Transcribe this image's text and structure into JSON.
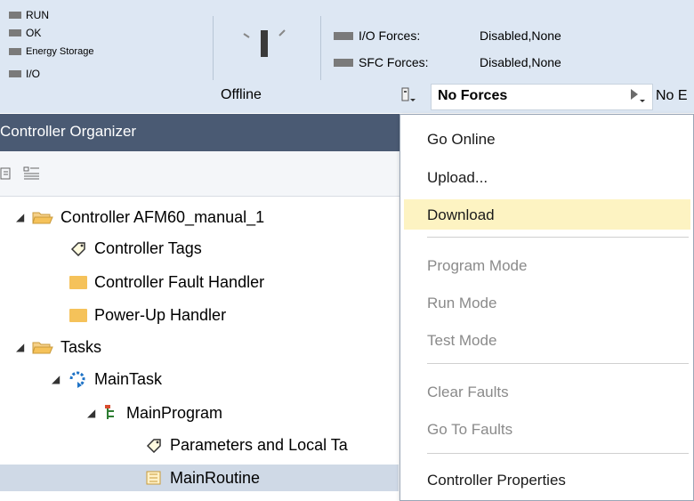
{
  "status_leds": [
    "RUN",
    "OK",
    "Energy Storage",
    "I/O"
  ],
  "forces": {
    "io_label": "I/O Forces:",
    "io_value": "Disabled,None",
    "sfc_label": "SFC Forces:",
    "sfc_value": "Disabled,None"
  },
  "mode": "Offline",
  "forces_status": "No Forces",
  "edits_status": "No E",
  "organizer": {
    "title": "Controller Organizer"
  },
  "tree": [
    "Controller AFM60_manual_1",
    "Controller Tags",
    "Controller Fault Handler",
    "Power-Up Handler",
    "Tasks",
    "MainTask",
    "MainProgram",
    "Parameters and Local Ta",
    "MainRoutine"
  ],
  "menu": {
    "items": [
      "Go Online",
      "Upload...",
      "Download",
      "Program Mode",
      "Run Mode",
      "Test Mode",
      "Clear Faults",
      "Go To Faults",
      "Controller Properties"
    ]
  },
  "colors": {
    "toolbar_bg": "#dde7f3",
    "header_bg": "#4a5a73",
    "menu_highlight": "#fdf3c2",
    "selected_row": "#cfd9e6",
    "folder": "#f5c25a"
  }
}
